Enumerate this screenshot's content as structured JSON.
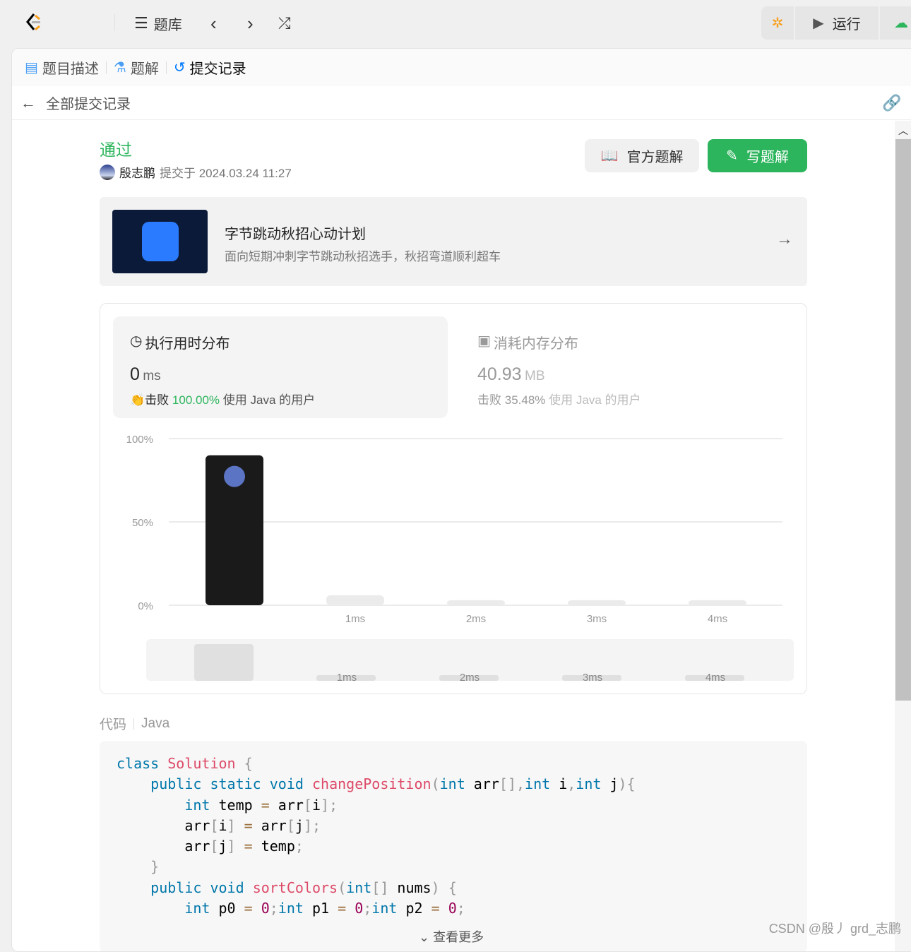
{
  "topbar": {
    "problems": "题库",
    "run": "运行"
  },
  "tabs": [
    {
      "label": "题目描述",
      "icon": "doc-icon"
    },
    {
      "label": "题解",
      "icon": "flask-icon"
    },
    {
      "label": "提交记录",
      "icon": "history-icon",
      "active": true
    }
  ],
  "back_label": "全部提交记录",
  "submission": {
    "status": "通过",
    "status_color": "#2db55d",
    "user": "殷志鹏",
    "submitted": "提交于 2024.03.24 11:27",
    "official_solution": "官方题解",
    "write_solution": "写题解"
  },
  "banner": {
    "title": "字节跳动秋招心动计划",
    "subtitle": "面向短期冲刺字节跳动秋招选手，秋招弯道顺利超车"
  },
  "runtime": {
    "title": "执行用时分布",
    "value": "0",
    "unit": "ms",
    "beat_prefix": "击败",
    "beat": "100.00%",
    "beat_suffix": "使用 Java 的用户"
  },
  "memory": {
    "title": "消耗内存分布",
    "value": "40.93",
    "unit": "MB",
    "beat_prefix": "击败",
    "beat": "35.48%",
    "beat_suffix": "使用 Java 的用户"
  },
  "chart_data": {
    "type": "bar",
    "categories": [
      "",
      "1ms",
      "2ms",
      "3ms",
      "4ms"
    ],
    "values": [
      90,
      6,
      3,
      3,
      3
    ],
    "yticks": [
      "100%",
      "50%",
      "0%"
    ],
    "ylim": [
      0,
      100
    ],
    "grid": true,
    "highlight_index": 0,
    "minimap_labels": [
      "1ms",
      "2ms",
      "3ms",
      "4ms"
    ]
  },
  "code": {
    "label": "代码",
    "language": "Java",
    "more": "查看更多",
    "lines": [
      [
        [
          "kw",
          "class"
        ],
        [
          "t",
          " "
        ],
        [
          "fn",
          "Solution"
        ],
        [
          "t",
          " "
        ],
        [
          "p",
          "{"
        ]
      ],
      [
        [
          "t",
          "    "
        ],
        [
          "kw",
          "public"
        ],
        [
          "t",
          " "
        ],
        [
          "kw",
          "static"
        ],
        [
          "t",
          " "
        ],
        [
          "kw",
          "void"
        ],
        [
          "t",
          " "
        ],
        [
          "fn",
          "changePosition"
        ],
        [
          "p",
          "("
        ],
        [
          "kw",
          "int"
        ],
        [
          "t",
          " arr"
        ],
        [
          "p",
          "[],"
        ],
        [
          "kw",
          "int"
        ],
        [
          "t",
          " i"
        ],
        [
          "p",
          ","
        ],
        [
          "kw",
          "int"
        ],
        [
          "t",
          " j"
        ],
        [
          "p",
          "){"
        ]
      ],
      [
        [
          "t",
          "        "
        ],
        [
          "kw",
          "int"
        ],
        [
          "t",
          " temp "
        ],
        [
          "op",
          "="
        ],
        [
          "t",
          " arr"
        ],
        [
          "p",
          "["
        ],
        [
          "t",
          "i"
        ],
        [
          "p",
          "];"
        ]
      ],
      [
        [
          "t",
          "        arr"
        ],
        [
          "p",
          "["
        ],
        [
          "t",
          "i"
        ],
        [
          "p",
          "]"
        ],
        [
          "t",
          " "
        ],
        [
          "op",
          "="
        ],
        [
          "t",
          " arr"
        ],
        [
          "p",
          "["
        ],
        [
          "t",
          "j"
        ],
        [
          "p",
          "];"
        ]
      ],
      [
        [
          "t",
          "        arr"
        ],
        [
          "p",
          "["
        ],
        [
          "t",
          "j"
        ],
        [
          "p",
          "]"
        ],
        [
          "t",
          " "
        ],
        [
          "op",
          "="
        ],
        [
          "t",
          " temp"
        ],
        [
          "p",
          ";"
        ]
      ],
      [
        [
          "t",
          "    "
        ],
        [
          "p",
          "}"
        ]
      ],
      [
        [
          "t",
          "    "
        ],
        [
          "kw",
          "public"
        ],
        [
          "t",
          " "
        ],
        [
          "kw",
          "void"
        ],
        [
          "t",
          " "
        ],
        [
          "fn",
          "sortColors"
        ],
        [
          "p",
          "("
        ],
        [
          "kw",
          "int"
        ],
        [
          "p",
          "[]"
        ],
        [
          "t",
          " nums"
        ],
        [
          "p",
          ")"
        ],
        [
          "t",
          " "
        ],
        [
          "p",
          "{"
        ]
      ],
      [
        [
          "t",
          "        "
        ],
        [
          "kw",
          "int"
        ],
        [
          "t",
          " p0 "
        ],
        [
          "op",
          "="
        ],
        [
          "t",
          " "
        ],
        [
          "num",
          "0"
        ],
        [
          "p",
          ";"
        ],
        [
          "kw",
          "int"
        ],
        [
          "t",
          " p1 "
        ],
        [
          "op",
          "="
        ],
        [
          "t",
          " "
        ],
        [
          "num",
          "0"
        ],
        [
          "p",
          ";"
        ],
        [
          "kw",
          "int"
        ],
        [
          "t",
          " p2 "
        ],
        [
          "op",
          "="
        ],
        [
          "t",
          " "
        ],
        [
          "num",
          "0"
        ],
        [
          "p",
          ";"
        ]
      ]
    ]
  },
  "watermark": "CSDN @殷丿 grd_志鹏"
}
